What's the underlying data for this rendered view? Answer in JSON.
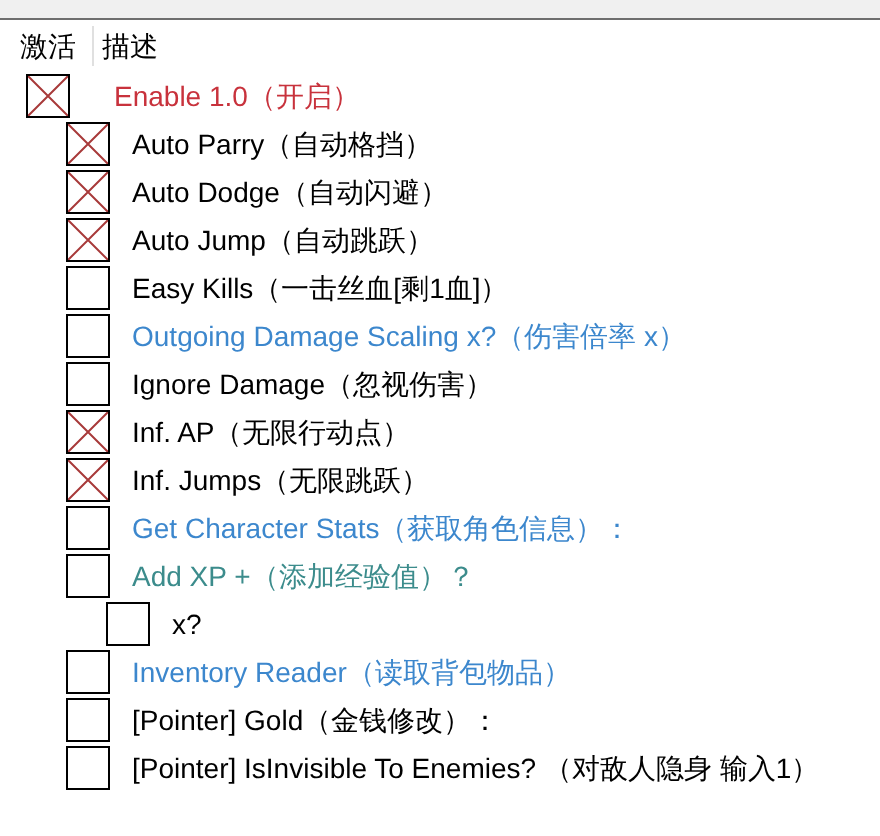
{
  "table": {
    "columns": [
      "激活",
      "描述"
    ],
    "rows": [
      {
        "label": "Enable 1.0（开启）",
        "checked": true,
        "color": "#c8323c",
        "children": [
          {
            "label": "Auto Parry（自动格挡）",
            "checked": true,
            "color": "#000000"
          },
          {
            "label": "Auto Dodge（自动闪避）",
            "checked": true,
            "color": "#000000"
          },
          {
            "label": "Auto Jump（自动跳跃）",
            "checked": true,
            "color": "#000000"
          },
          {
            "label": "Easy Kills（一击丝血[剩1血]）",
            "checked": false,
            "color": "#000000"
          },
          {
            "label": "Outgoing Damage Scaling x?（伤害倍率 x）",
            "checked": false,
            "color": "#3c87cd"
          },
          {
            "label": "Ignore Damage（忽视伤害）",
            "checked": false,
            "color": "#000000"
          },
          {
            "label": "Inf. AP（无限行动点）",
            "checked": true,
            "color": "#000000"
          },
          {
            "label": "Inf. Jumps（无限跳跃）",
            "checked": true,
            "color": "#000000"
          },
          {
            "label": "Get Character Stats（获取角色信息）：",
            "checked": false,
            "color": "#3c87cd"
          },
          {
            "label": "Add XP +（添加经验值）？",
            "checked": false,
            "color": "#3c8c8c",
            "children": [
              {
                "label": "x?",
                "checked": false,
                "color": "#000000"
              }
            ]
          },
          {
            "label": "Inventory Reader（读取背包物品）",
            "checked": false,
            "color": "#3c87cd"
          },
          {
            "label": "[Pointer] Gold（金钱修改）：",
            "checked": false,
            "color": "#000000"
          },
          {
            "label": "[Pointer] IsInvisible To Enemies? （对敌人隐身 输入1）",
            "checked": false,
            "color": "#000000"
          }
        ]
      }
    ]
  }
}
